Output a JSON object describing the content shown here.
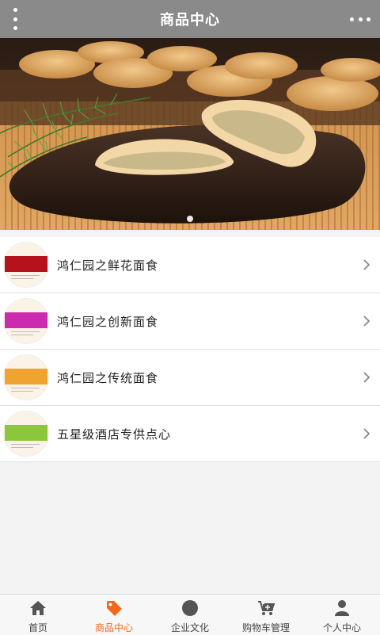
{
  "header": {
    "title": "商品中心",
    "menu_icon": "vertical-dots-icon",
    "more_icon": "horizontal-dots-icon"
  },
  "banner": {
    "slides": 1,
    "active_slide": 1
  },
  "products": [
    {
      "label": "鸿仁园之鲜花面食",
      "thumb_color": "#b5121b"
    },
    {
      "label": "鸿仁园之创新面食",
      "thumb_color": "#cc2bb0"
    },
    {
      "label": "鸿仁园之传统面食",
      "thumb_color": "#f0a330"
    },
    {
      "label": "五星级酒店专供点心",
      "thumb_color": "#8cc63f"
    }
  ],
  "tabbar": {
    "active_color": "#f06a1a",
    "items": [
      {
        "label": "首页",
        "icon": "home-icon"
      },
      {
        "label": "商品中心",
        "icon": "tag-icon"
      },
      {
        "label": "企业文化",
        "icon": "circle-icon"
      },
      {
        "label": "购物车管理",
        "icon": "cart-icon"
      },
      {
        "label": "个人中心",
        "icon": "user-icon"
      }
    ]
  }
}
